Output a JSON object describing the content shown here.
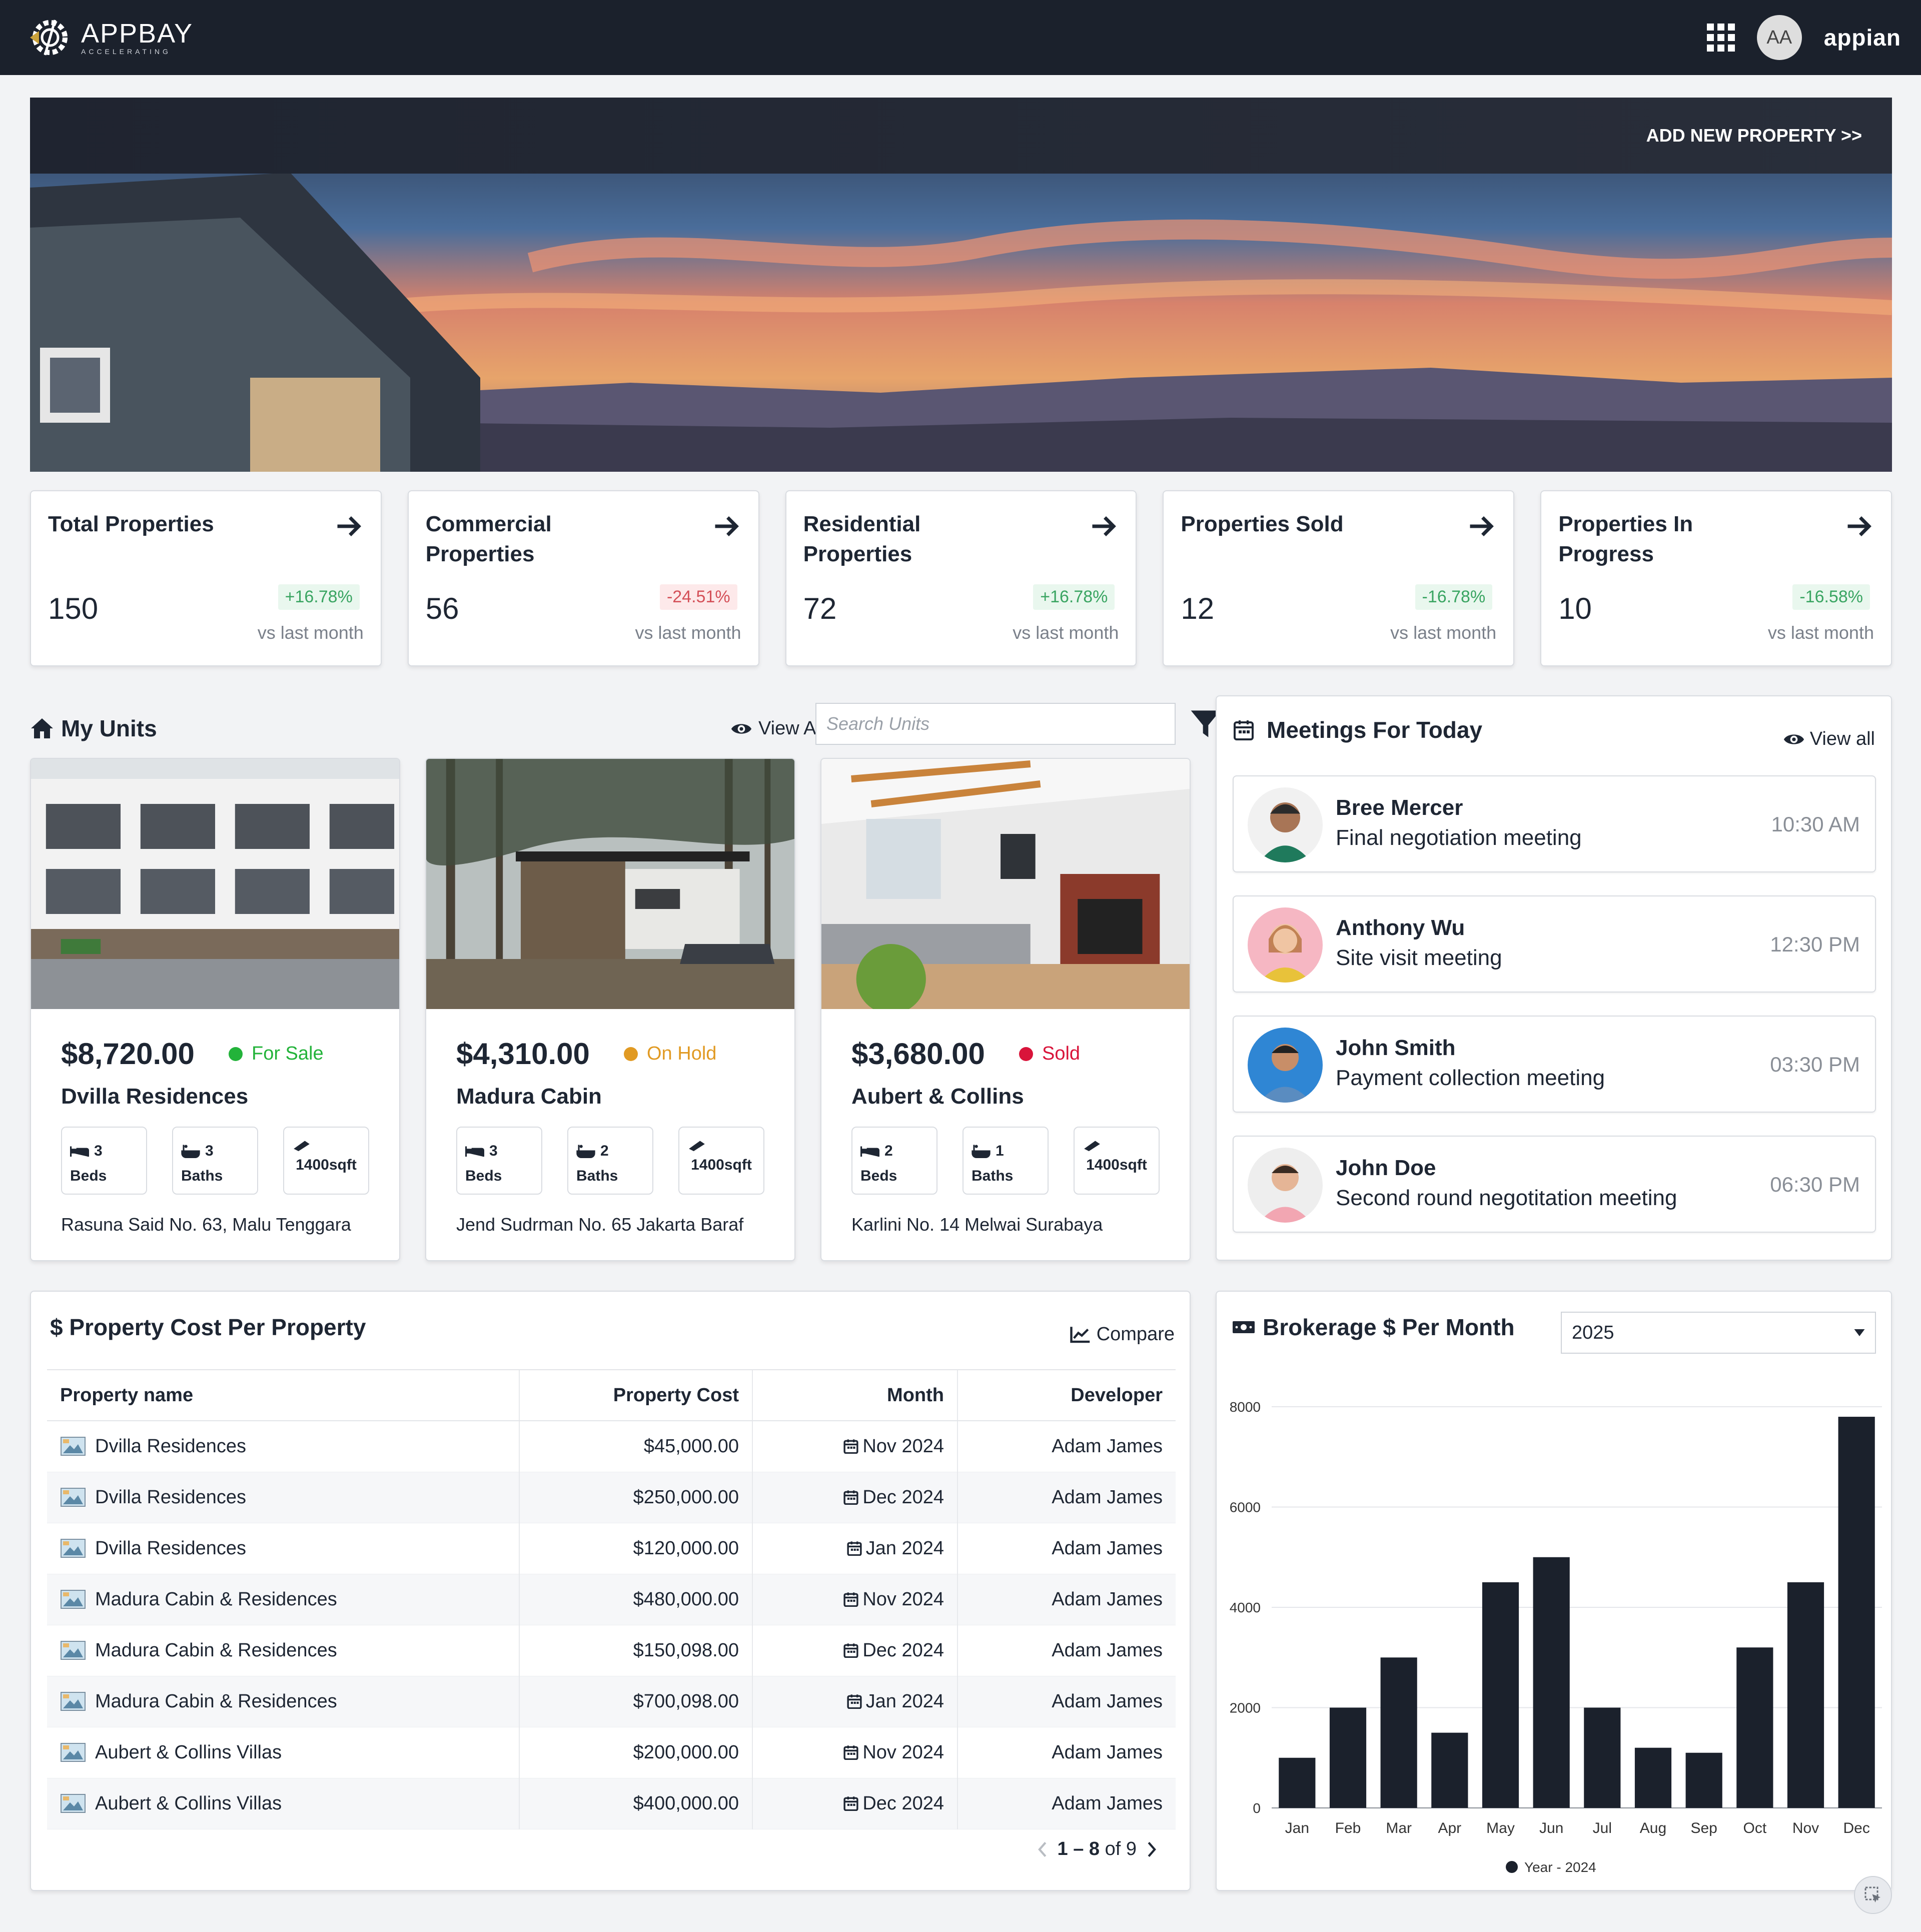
{
  "header": {
    "brand_name": "APPBAY",
    "brand_tag": "ACCELERATING",
    "user_initials": "AA",
    "vendor": "appian"
  },
  "hero": {
    "cta": "ADD NEW PROPERTY >>"
  },
  "kpis": [
    {
      "title": "Total Properties",
      "value": "150",
      "change": "+16.78%",
      "tone": "pos",
      "sub": "vs last month"
    },
    {
      "title": "Commercial Properties",
      "value": "56",
      "change": "-24.51%",
      "tone": "neg",
      "sub": "vs last month"
    },
    {
      "title": "Residential Properties",
      "value": "72",
      "change": "+16.78%",
      "tone": "pos",
      "sub": "vs last month"
    },
    {
      "title": "Properties Sold",
      "value": "12",
      "change": "-16.78%",
      "tone": "pos",
      "sub": "vs last month"
    },
    {
      "title": "Properties In Progress",
      "value": "10",
      "change": "-16.58%",
      "tone": "pos",
      "sub": "vs last month"
    }
  ],
  "units": {
    "title": "My Units",
    "view_all": "View All",
    "search_placeholder": "Search Units",
    "items": [
      {
        "price": "$8,720.00",
        "status": "For Sale",
        "status_color": "#23b33a",
        "name": "Dvilla Residences",
        "beds": "3",
        "beds_label": "Beds",
        "baths": "3",
        "baths_label": "Baths",
        "area": "1400sqft",
        "address": "Rasuna Said No. 63, Malu Tenggara"
      },
      {
        "price": "$4,310.00",
        "status": "On Hold",
        "status_color": "#e19a23",
        "name": "Madura Cabin",
        "beds": "3",
        "beds_label": "Beds",
        "baths": "2",
        "baths_label": "Baths",
        "area": "1400sqft",
        "address": "Jend Sudrman No. 65 Jakarta Baraf"
      },
      {
        "price": "$3,680.00",
        "status": "Sold",
        "status_color": "#d9143a",
        "name": "Aubert & Collins",
        "beds": "2",
        "beds_label": "Beds",
        "baths": "1",
        "baths_label": "Baths",
        "area": "1400sqft",
        "address": "Karlini No. 14  Melwai Surabaya"
      }
    ]
  },
  "meetings": {
    "title": "Meetings For Today",
    "view_all": "View all",
    "items": [
      {
        "name": "Bree Mercer",
        "desc": "Final negotiation meeting",
        "time": "10:30 AM"
      },
      {
        "name": "Anthony Wu",
        "desc": "Site visit meeting",
        "time": "12:30 PM"
      },
      {
        "name": "John Smith",
        "desc": "Payment collection meeting",
        "time": "03:30 PM"
      },
      {
        "name": "John Doe",
        "desc": "Second round negotitation meeting",
        "time": "06:30 PM"
      }
    ]
  },
  "cost": {
    "title": "$ Property Cost Per Property",
    "compare": "Compare",
    "columns": [
      "Property name",
      "Property Cost",
      "Month",
      "Developer"
    ],
    "rows": [
      [
        "Dvilla Residences",
        "$45,000.00",
        "Nov 2024",
        "Adam James"
      ],
      [
        "Dvilla Residences",
        "$250,000.00",
        "Dec 2024",
        "Adam James"
      ],
      [
        "Dvilla Residences",
        "$120,000.00",
        "Jan 2024",
        "Adam James"
      ],
      [
        "Madura Cabin & Residences",
        "$480,000.00",
        "Nov 2024",
        "Adam James"
      ],
      [
        "Madura Cabin & Residences",
        "$150,098.00",
        "Dec 2024",
        "Adam James"
      ],
      [
        "Madura Cabin & Residences",
        "$700,098.00",
        "Jan 2024",
        "Adam James"
      ],
      [
        "Aubert & Collins Villas",
        "$200,000.00",
        "Nov 2024",
        "Adam James"
      ],
      [
        "Aubert & Collins Villas",
        "$400,000.00",
        "Dec 2024",
        "Adam James"
      ]
    ],
    "pager_range": "1 – 8",
    "pager_total": "of 9"
  },
  "brokerage": {
    "title": "Brokerage $ Per Month",
    "year_selected": "2025"
  },
  "chart_data": {
    "type": "bar",
    "categories": [
      "Jan",
      "Feb",
      "Mar",
      "Apr",
      "May",
      "Jun",
      "Jul",
      "Aug",
      "Sep",
      "Oct",
      "Nov",
      "Dec"
    ],
    "series": [
      {
        "name": "Year - 2024",
        "values": [
          1000,
          2000,
          3000,
          1500,
          4500,
          5000,
          2000,
          1200,
          1100,
          3200,
          4500,
          7800
        ]
      }
    ],
    "yticks": [
      0,
      2000,
      4000,
      6000,
      8000
    ],
    "ylim": [
      0,
      8000
    ],
    "grid": true,
    "legend": "bottom",
    "bar_color": "#1b212c"
  }
}
